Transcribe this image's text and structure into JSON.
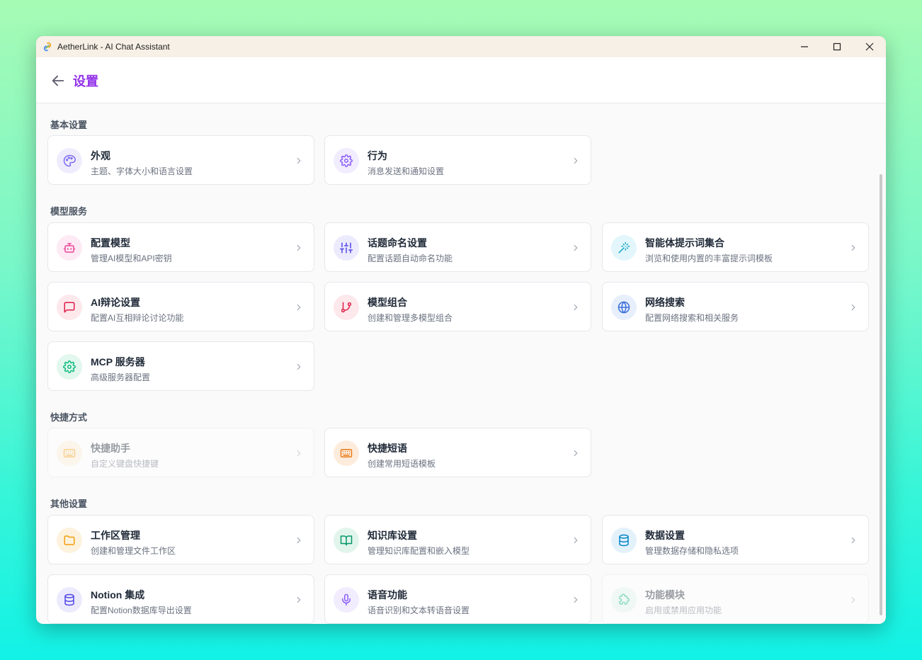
{
  "window": {
    "title": "AetherLink - AI Chat Assistant"
  },
  "header": {
    "title": "设置"
  },
  "sections": [
    {
      "title": "基本设置"
    },
    {
      "title": "模型服务"
    },
    {
      "title": "快捷方式"
    },
    {
      "title": "其他设置"
    }
  ],
  "cards": {
    "appearance": {
      "title": "外观",
      "desc": "主题、字体大小和语言设置",
      "icon": "palette-icon",
      "color": "#7c6cf0",
      "bg": "#efedfd"
    },
    "behavior": {
      "title": "行为",
      "desc": "消息发送和通知设置",
      "icon": "gear-icon",
      "color": "#8b5cf6",
      "bg": "#f1ecfe"
    },
    "model_config": {
      "title": "配置模型",
      "desc": "管理AI模型和API密钥",
      "icon": "bot-icon",
      "color": "#ec4899",
      "bg": "#fdeaf4"
    },
    "topic_naming": {
      "title": "话题命名设置",
      "desc": "配置话题自动命名功能",
      "icon": "sliders-icon",
      "color": "#4f46e5",
      "bg": "#eceafd"
    },
    "agent_prompts": {
      "title": "智能体提示词集合",
      "desc": "浏览和使用内置的丰富提示词模板",
      "icon": "magic-wand-icon",
      "color": "#0ea5c6",
      "bg": "#e3f6fb"
    },
    "ai_debate": {
      "title": "AI辩论设置",
      "desc": "配置AI互相辩论讨论功能",
      "icon": "message-icon",
      "color": "#e11d48",
      "bg": "#fde8ec"
    },
    "model_combo": {
      "title": "模型组合",
      "desc": "创建和管理多模型组合",
      "icon": "git-branch-icon",
      "color": "#e11d48",
      "bg": "#fde8ec"
    },
    "web_search": {
      "title": "网络搜索",
      "desc": "配置网络搜索和相关服务",
      "icon": "globe-icon",
      "color": "#3b6fd8",
      "bg": "#e8effc"
    },
    "mcp_server": {
      "title": "MCP 服务器",
      "desc": "高级服务器配置",
      "icon": "gear-icon",
      "color": "#10b981",
      "bg": "#e2f7ee"
    },
    "quick_assistant": {
      "title": "快捷助手",
      "desc": "自定义键盘快捷键",
      "icon": "keyboard-icon",
      "color": "#f59e0b",
      "bg": "#fdf1dc"
    },
    "quick_phrases": {
      "title": "快捷短语",
      "desc": "创建常用短语模板",
      "icon": "keyboard-icon",
      "color": "#ea7a18",
      "bg": "#fdecdc"
    },
    "workspace": {
      "title": "工作区管理",
      "desc": "创建和管理文件工作区",
      "icon": "folder-icon",
      "color": "#f59e0b",
      "bg": "#fdf2dd"
    },
    "knowledge": {
      "title": "知识库设置",
      "desc": "管理知识库配置和嵌入模型",
      "icon": "book-open-icon",
      "color": "#059669",
      "bg": "#e2f5ec"
    },
    "data": {
      "title": "数据设置",
      "desc": "管理数据存储和隐私选项",
      "icon": "database-icon",
      "color": "#0284c7",
      "bg": "#e3f1fb"
    },
    "notion": {
      "title": "Notion 集成",
      "desc": "配置Notion数据库导出设置",
      "icon": "database-icon",
      "color": "#4f46e5",
      "bg": "#eceafd"
    },
    "voice": {
      "title": "语音功能",
      "desc": "语音识别和文本转语音设置",
      "icon": "microphone-icon",
      "color": "#8b5cf6",
      "bg": "#f1ecfe"
    },
    "feature_modules": {
      "title": "功能模块",
      "desc": "启用或禁用应用功能",
      "icon": "puzzle-icon",
      "color": "#10b981",
      "bg": "#e2f7ee"
    }
  }
}
